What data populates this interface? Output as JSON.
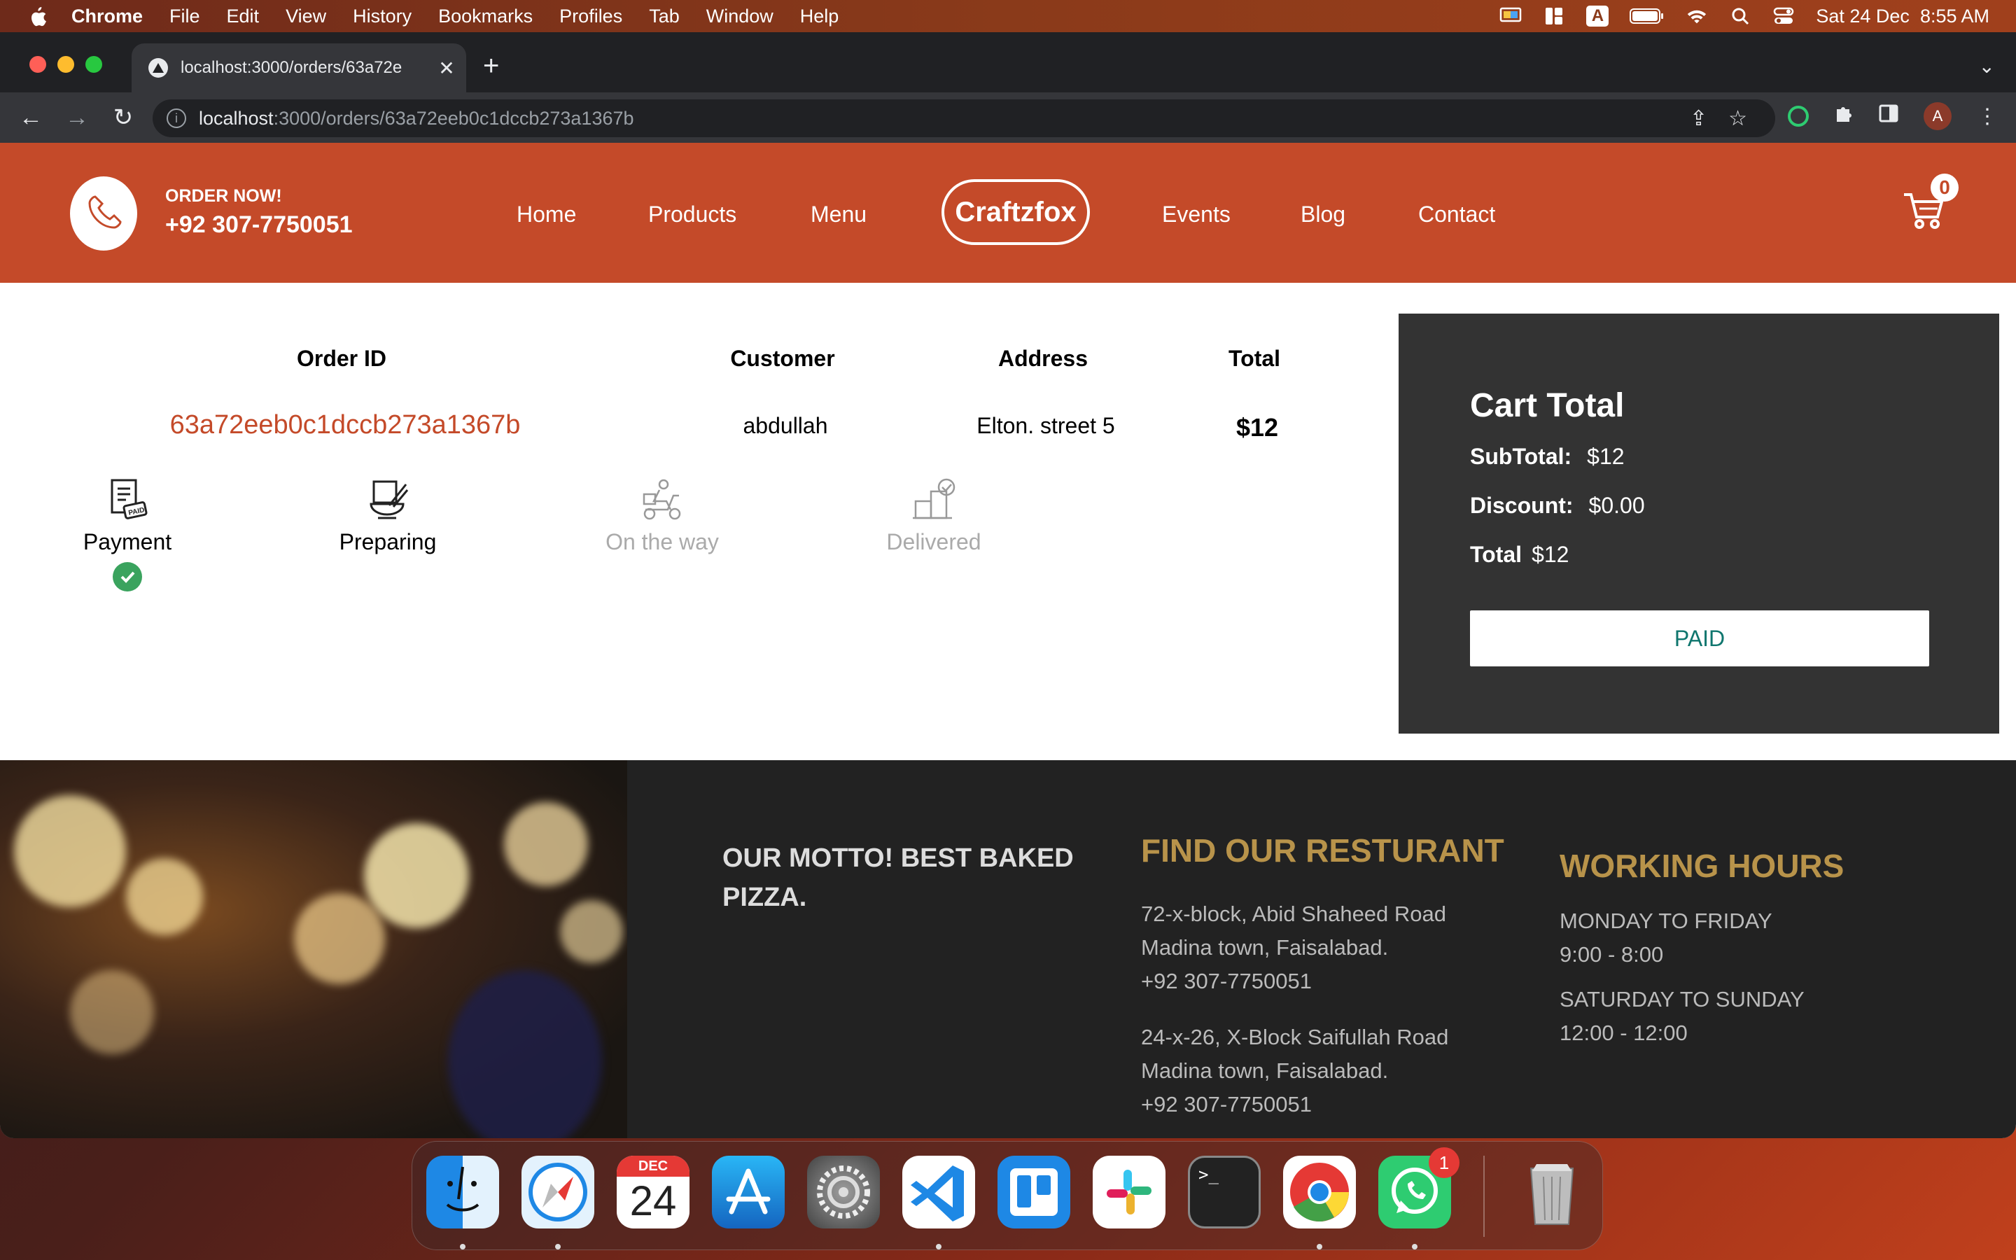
{
  "menubar": {
    "app": "Chrome",
    "items": [
      "File",
      "Edit",
      "View",
      "History",
      "Bookmarks",
      "Profiles",
      "Tab",
      "Window",
      "Help"
    ],
    "keyboard": "A",
    "datetime": "Sat 24 Dec  8:55 AM"
  },
  "browser": {
    "tab_title": "localhost:3000/orders/63a72e",
    "url_host": "localhost",
    "url_path": ":3000/orders/63a72eeb0c1dccb273a1367b",
    "avatar": "A"
  },
  "site": {
    "order_now": "ORDER NOW!",
    "phone": "+92 307-7750051",
    "nav": [
      "Home",
      "Products",
      "Menu",
      "Events",
      "Blog",
      "Contact"
    ],
    "logo": "Craftzfox",
    "cart_count": "0"
  },
  "order": {
    "headers": {
      "id": "Order ID",
      "customer": "Customer",
      "address": "Address",
      "total": "Total"
    },
    "id": "63a72eeb0c1dccb273a1367b",
    "customer": "abdullah",
    "address": "Elton. street 5",
    "total": "$12"
  },
  "steps": [
    {
      "label": "Payment",
      "icon": "paid-receipt-icon",
      "state": "done"
    },
    {
      "label": "Preparing",
      "icon": "cooking-bowl-icon",
      "state": "done"
    },
    {
      "label": "On the way",
      "icon": "delivery-scooter-icon",
      "state": "pending"
    },
    {
      "label": "Delivered",
      "icon": "delivered-box-icon",
      "state": "pending"
    }
  ],
  "cart_total": {
    "title": "Cart Total",
    "subtotal_label": "SubTotal:",
    "subtotal": "$12",
    "discount_label": "Discount:",
    "discount": "$0.00",
    "total_label": "Total",
    "total": "$12",
    "button": "PAID"
  },
  "footer": {
    "motto": "OUR MOTTO! BEST BAKED PIZZA.",
    "find_title": "FIND OUR RESTURANT",
    "loc1": [
      "72-x-block, Abid Shaheed Road",
      "Madina town, Faisalabad.",
      "+92 307-7750051"
    ],
    "loc2": [
      "24-x-26, X-Block Saifullah Road",
      "Madina town, Faisalabad.",
      "+92 307-7750051"
    ],
    "hours_title": "WORKING HOURS",
    "weekdays": "MONDAY TO FRIDAY",
    "weekday_hours": "9:00 - 8:00",
    "weekend": "SATURDAY TO SUNDAY",
    "weekend_hours": "12:00 - 12:00"
  },
  "dock": {
    "calendar_month": "DEC",
    "calendar_day": "24",
    "whatsapp_badge": "1"
  },
  "colors": {
    "brand": "#c44a29",
    "panel": "#333333",
    "footer_heading": "#b8934a",
    "paid_text": "#0f766e"
  }
}
